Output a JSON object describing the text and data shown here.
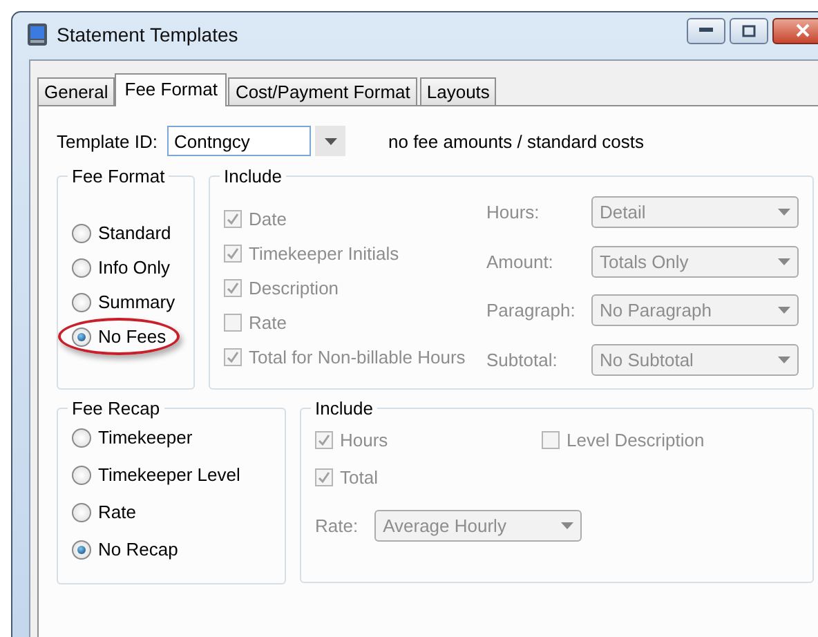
{
  "window": {
    "title": "Statement Templates"
  },
  "tabs": [
    {
      "label": "General",
      "selected": false
    },
    {
      "label": "Fee Format",
      "selected": true
    },
    {
      "label": "Cost/Payment Format",
      "selected": false
    },
    {
      "label": "Layouts",
      "selected": false
    }
  ],
  "template": {
    "label": "Template ID:",
    "value": "Contngcy",
    "description": "no fee amounts / standard costs"
  },
  "fee_format": {
    "title": "Fee Format",
    "options": [
      {
        "label": "Standard",
        "selected": false,
        "annotated": false
      },
      {
        "label": "Info Only",
        "selected": false,
        "annotated": false
      },
      {
        "label": "Summary",
        "selected": false,
        "annotated": false
      },
      {
        "label": "No Fees",
        "selected": true,
        "annotated": true
      }
    ]
  },
  "fee_include": {
    "title": "Include",
    "disabled": true,
    "checkboxes": [
      {
        "label": "Date",
        "checked": true
      },
      {
        "label": "Timekeeper Initials",
        "checked": true
      },
      {
        "label": "Description",
        "checked": true
      },
      {
        "label": "Rate",
        "checked": false
      },
      {
        "label": "Total for Non-billable Hours",
        "checked": true
      }
    ],
    "dropdowns": [
      {
        "label": "Hours:",
        "value": "Detail"
      },
      {
        "label": "Amount:",
        "value": "Totals Only"
      },
      {
        "label": "Paragraph:",
        "value": "No Paragraph"
      },
      {
        "label": "Subtotal:",
        "value": "No Subtotal"
      }
    ]
  },
  "fee_recap": {
    "title": "Fee Recap",
    "options": [
      {
        "label": "Timekeeper",
        "selected": false,
        "annotated": false
      },
      {
        "label": "Timekeeper Level",
        "selected": false,
        "annotated": false
      },
      {
        "label": "Rate",
        "selected": false,
        "annotated": false
      },
      {
        "label": "No Recap",
        "selected": true,
        "annotated": false
      }
    ]
  },
  "recap_include": {
    "title": "Include",
    "disabled": true,
    "checkboxes": [
      {
        "label": "Hours",
        "checked": true
      },
      {
        "label": "Level Description",
        "checked": false
      },
      {
        "label": "Total",
        "checked": true
      }
    ],
    "dropdowns": [
      {
        "label": "Rate:",
        "value": "Average Hourly"
      }
    ]
  }
}
